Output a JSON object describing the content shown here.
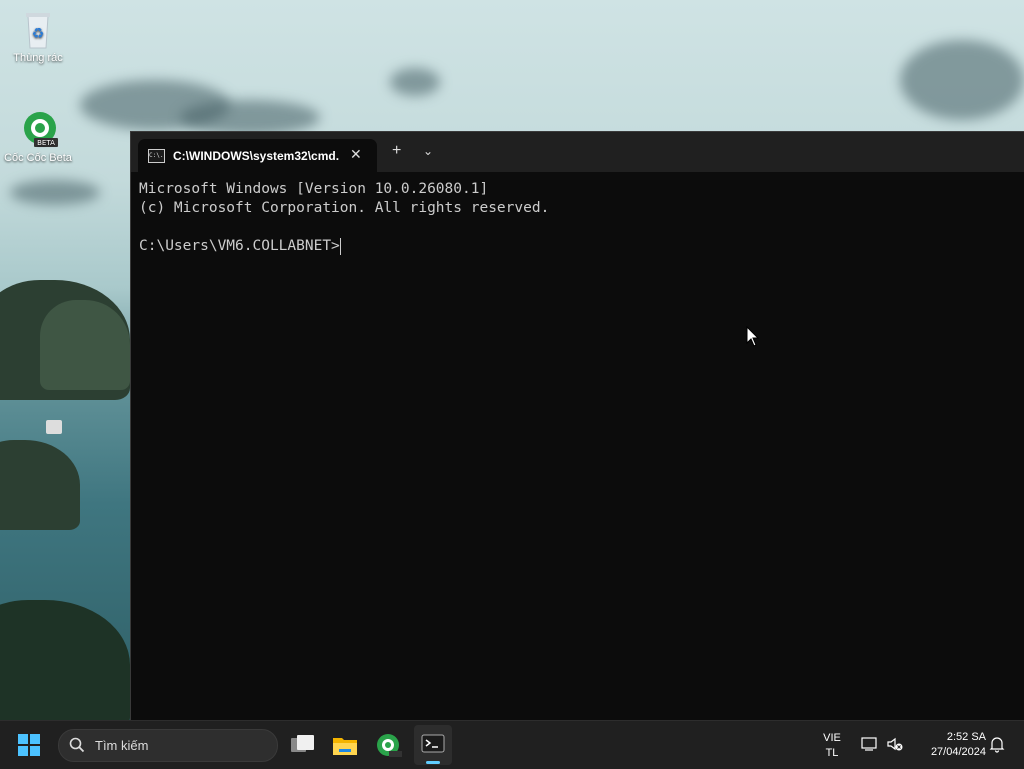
{
  "desktop": {
    "icons": [
      {
        "label": "Thùng rác",
        "icon": "recycle-bin-icon"
      },
      {
        "label": "Cốc Cốc Beta",
        "icon": "coccoc-beta-icon",
        "badge": "BETA"
      }
    ]
  },
  "terminal": {
    "tab_title": "C:\\WINDOWS\\system32\\cmd.",
    "tab_icon_text": "C:\\.",
    "close_glyph": "✕",
    "new_tab_glyph": "+",
    "dropdown_glyph": "⌄",
    "lines": [
      "Microsoft Windows [Version 10.0.26080.1]",
      "(c) Microsoft Corporation. All rights reserved.",
      "",
      "C:\\Users\\VM6.COLLABNET>"
    ]
  },
  "taskbar": {
    "search_placeholder": "Tìm kiếm",
    "apps": [
      "task-view-icon",
      "file-explorer-icon",
      "coccoc-icon",
      "terminal-icon"
    ],
    "language_top": "VIE",
    "language_bottom": "TL",
    "time": "2:52 SA",
    "date": "27/04/2024"
  },
  "colors": {
    "terminal_bg": "#0c0c0c",
    "titlebar_bg": "#202020",
    "taskbar_bg": "#202020",
    "text": "#cccccc",
    "accent": "#60cdff"
  }
}
